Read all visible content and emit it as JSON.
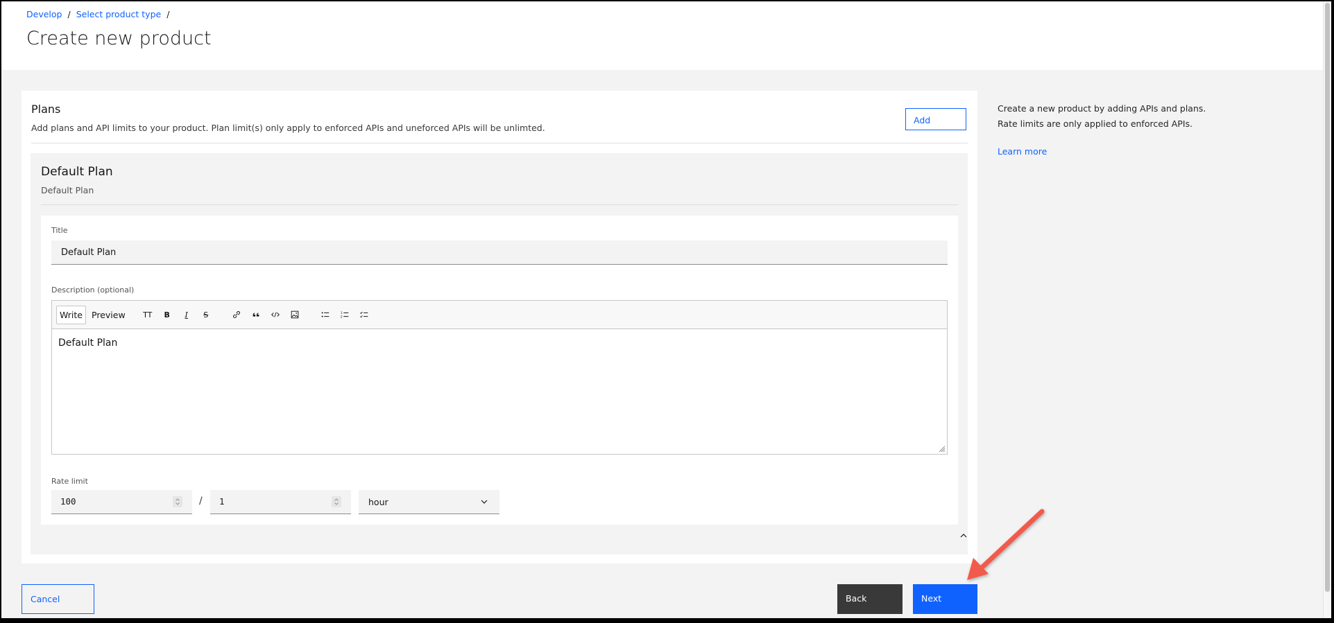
{
  "breadcrumb": {
    "items": [
      "Develop",
      "Select product type"
    ],
    "separator": "/"
  },
  "page": {
    "title": "Create new product"
  },
  "plans": {
    "title": "Plans",
    "description": "Add plans and API limits to your product. Plan limit(s) only apply to enforced APIs and uneforced APIs will be unlimted.",
    "add_label": "Add"
  },
  "plan": {
    "title": "Default Plan",
    "subtitle": "Default Plan",
    "form": {
      "title_label": "Title",
      "title_value": "Default Plan",
      "description_label": "Description (optional)",
      "editor": {
        "write_tab": "Write",
        "preview_tab": "Preview",
        "toolbar_icons": [
          "text-size-icon",
          "bold-icon",
          "italic-icon",
          "strikethrough-icon",
          "link-icon",
          "quote-icon",
          "code-icon",
          "image-icon",
          "bulleted-list-icon",
          "numbered-list-icon",
          "task-list-icon"
        ],
        "heading_glyph": "TT",
        "bold_glyph": "B",
        "italic_glyph": "I",
        "strike_glyph": "S",
        "content": "Default Plan"
      },
      "rate_limit": {
        "label": "Rate limit",
        "requests": "100",
        "separator": "/",
        "period_count": "1",
        "period_unit": "hour"
      }
    }
  },
  "info": {
    "line1": "Create a new product by adding APIs and plans.",
    "line2": "Rate limits are only applied to enforced APIs.",
    "learn_more": "Learn more"
  },
  "footer": {
    "cancel_label": "Cancel",
    "back_label": "Back",
    "next_label": "Next"
  },
  "colors": {
    "primary": "#0f62fe",
    "secondary_button": "#393939",
    "annotation_arrow": "#f25a4b",
    "background": "#f3f3f3"
  }
}
